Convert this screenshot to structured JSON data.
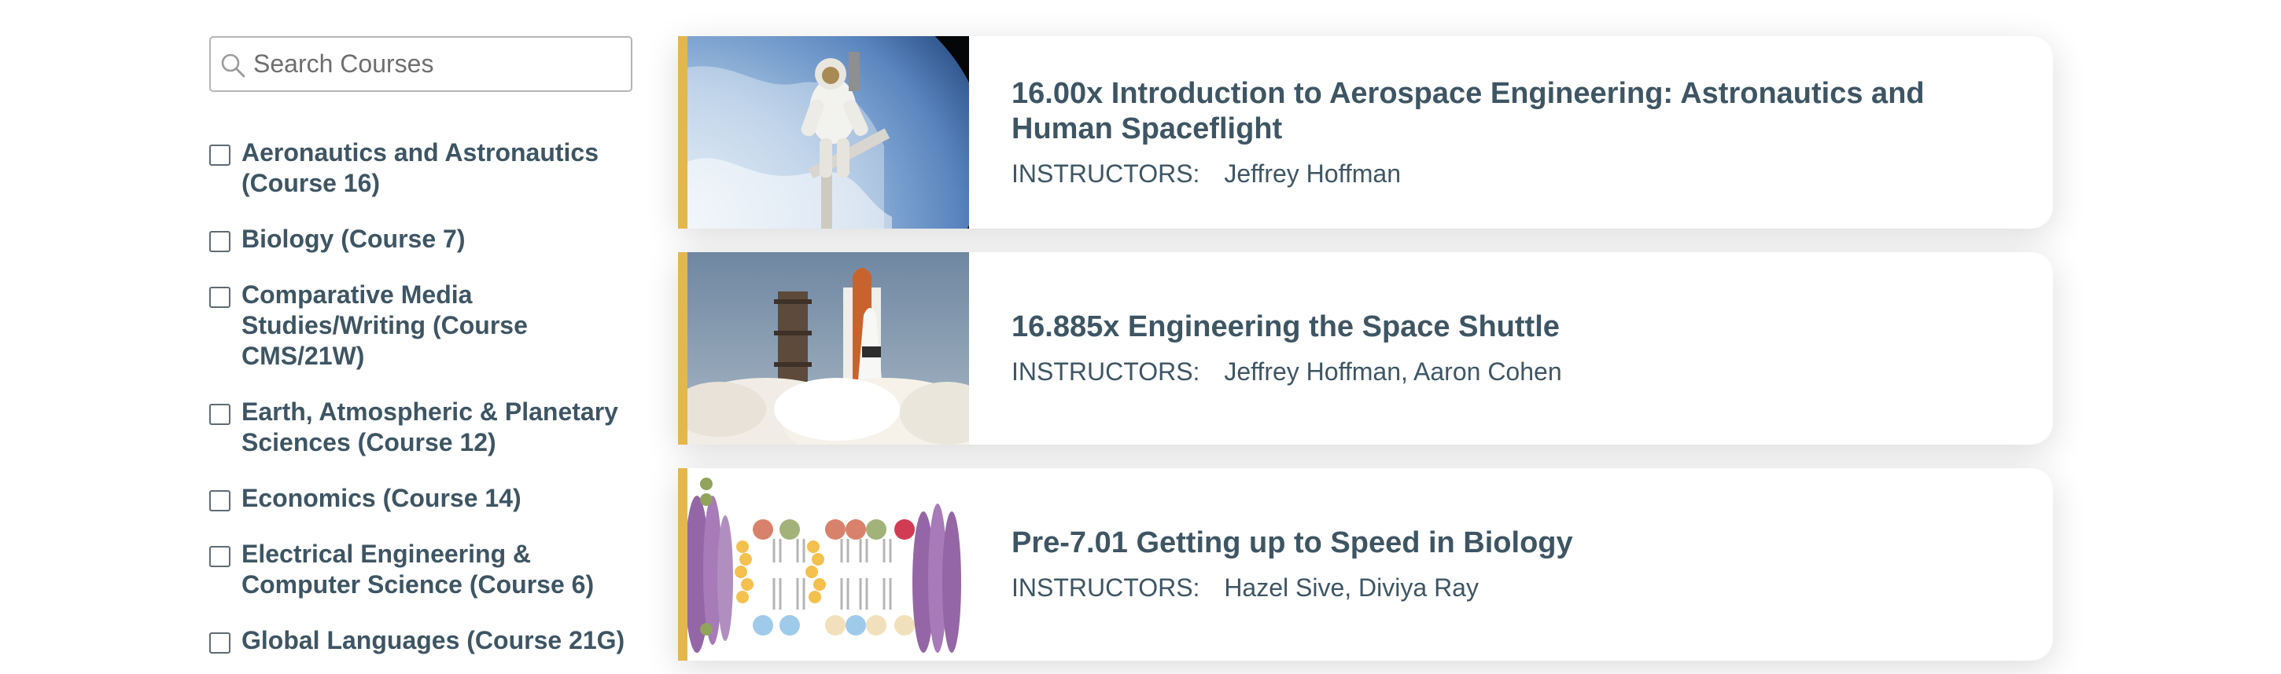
{
  "search": {
    "placeholder": "Search Courses",
    "value": ""
  },
  "filters": [
    {
      "label": "Aeronautics and Astronautics (Course 16)",
      "checked": false
    },
    {
      "label": "Biology (Course 7)",
      "checked": false
    },
    {
      "label": "Comparative Media Studies/Writing (Course CMS/21W)",
      "checked": false
    },
    {
      "label": "Earth, Atmospheric & Planetary Sciences (Course 12)",
      "checked": false
    },
    {
      "label": "Economics (Course 14)",
      "checked": false
    },
    {
      "label": "Electrical Engineering & Computer Science (Course 6)",
      "checked": false
    },
    {
      "label": "Global Languages (Course 21G)",
      "checked": false
    }
  ],
  "courses": [
    {
      "title": "16.00x Introduction to Aerospace Engineering: Astronautics and Human Spaceflight",
      "instructors_label": "INSTRUCTORS:",
      "instructors": "Jeffrey Hoffman",
      "image": "astronaut-spacewalk"
    },
    {
      "title": "16.885x Engineering the Space Shuttle",
      "instructors_label": "INSTRUCTORS:",
      "instructors": "Jeffrey Hoffman, Aaron Cohen",
      "image": "space-shuttle-launch"
    },
    {
      "title": "Pre-7.01 Getting up to Speed in Biology",
      "instructors_label": "INSTRUCTORS:",
      "instructors": "Hazel Sive, Diviya Ray",
      "image": "cell-membrane-diagram"
    }
  ],
  "colors": {
    "accent": "#e3b74a",
    "text": "#3e5563"
  }
}
